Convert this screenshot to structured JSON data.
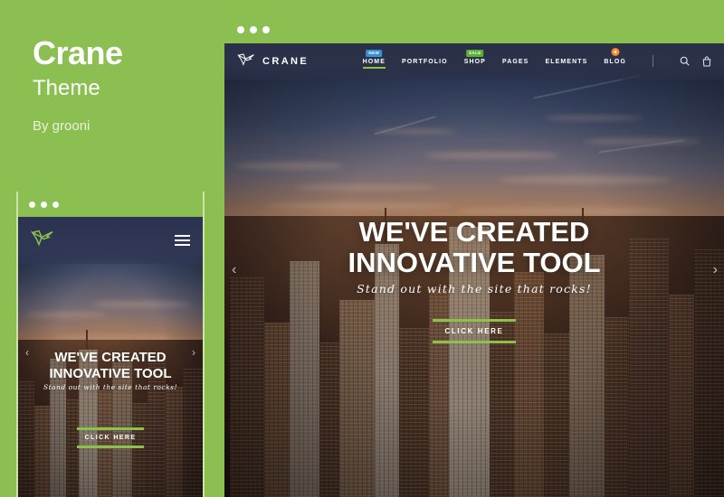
{
  "theme": {
    "name": "Crane",
    "subtitle": "Theme",
    "author": "By grooni"
  },
  "colors": {
    "brand_green": "#8bbf52",
    "accent_green": "#8bc34a",
    "navbar_navy": "#2b3148",
    "badge_new": "#3a8fd4",
    "badge_sale": "#5cb036",
    "badge_dot": "#f08a2b"
  },
  "site": {
    "logo_text": "CRANE",
    "logo_icon": "origami-crane-icon",
    "nav": [
      {
        "label": "HOME",
        "badge": "NEW",
        "badge_type": "new",
        "active": true
      },
      {
        "label": "PORTFOLIO",
        "badge": null,
        "badge_type": null,
        "active": false
      },
      {
        "label": "SHOP",
        "badge": "SALE",
        "badge_type": "sale",
        "active": false
      },
      {
        "label": "PAGES",
        "badge": null,
        "badge_type": null,
        "active": false
      },
      {
        "label": "ELEMENTS",
        "badge": null,
        "badge_type": null,
        "active": false
      },
      {
        "label": "BLOG",
        "badge": "",
        "badge_type": "dot",
        "active": false
      }
    ],
    "icons": [
      {
        "name": "search-icon"
      },
      {
        "name": "shopping-bag-icon"
      }
    ],
    "hero": {
      "line1": "WE'VE CREATED",
      "line2": "INNOVATIVE TOOL",
      "subtitle": "Stand out with the site that rocks!",
      "cta_label": "CLICK HERE",
      "prev_arrow": "‹",
      "next_arrow": "›"
    }
  },
  "window_controls": {
    "dots": [
      "dot-1",
      "dot-2",
      "dot-3"
    ]
  },
  "mobile": {
    "menu_icon": "hamburger-menu-icon",
    "logo_icon": "origami-crane-icon"
  }
}
